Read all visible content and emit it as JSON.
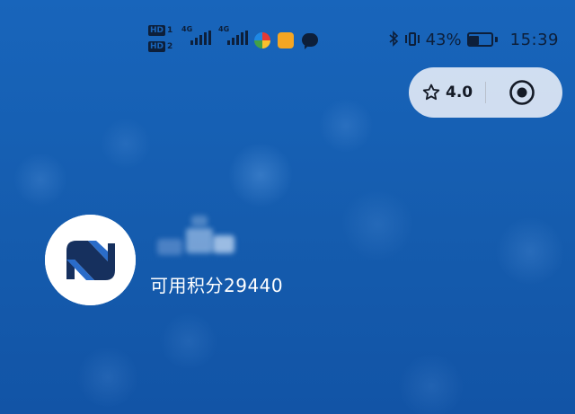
{
  "status_bar": {
    "sim1_label": "HD",
    "sim1_index": "1",
    "sim2_label": "HD",
    "sim2_index": "2",
    "network1": "4G",
    "network2": "4G",
    "battery_percent": "43%",
    "battery_level": 0.43,
    "time": "15:39",
    "icons": [
      "bluetooth-icon",
      "vibrate-icon",
      "battery-icon",
      "colorful-app-icon",
      "orange-app-icon",
      "chat-bubble-icon"
    ]
  },
  "capsule": {
    "rating": "4.0",
    "icons": [
      "star-icon",
      "target-icon"
    ]
  },
  "profile": {
    "points_label": "可用积分29440"
  },
  "colors": {
    "background": "#1865bb",
    "capsule_bg": "#e1e8f5",
    "logo_dark": "#16305e",
    "logo_light": "#2a6cc9",
    "text_white": "#ffffff"
  }
}
